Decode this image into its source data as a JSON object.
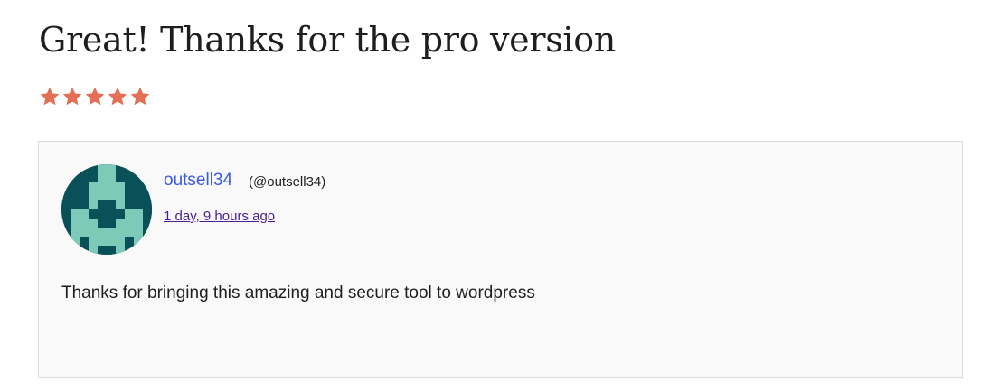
{
  "review": {
    "title": "Great! Thanks for the pro version",
    "rating": 5,
    "rating_max": 5,
    "star_color": "#e26f56",
    "author": {
      "name": "outsell34",
      "handle": "(@outsell34)",
      "avatar_icon": "identicon-avatar"
    },
    "date": "1 day, 9 hours ago",
    "body": "Thanks for bringing this amazing and secure tool to wordpress"
  },
  "colors": {
    "link": "#3858e9",
    "visited_link": "#4b1d8f",
    "card_background": "#f9f9f9",
    "avatar_dark": "#0a5058",
    "avatar_light": "#7ecab8"
  }
}
